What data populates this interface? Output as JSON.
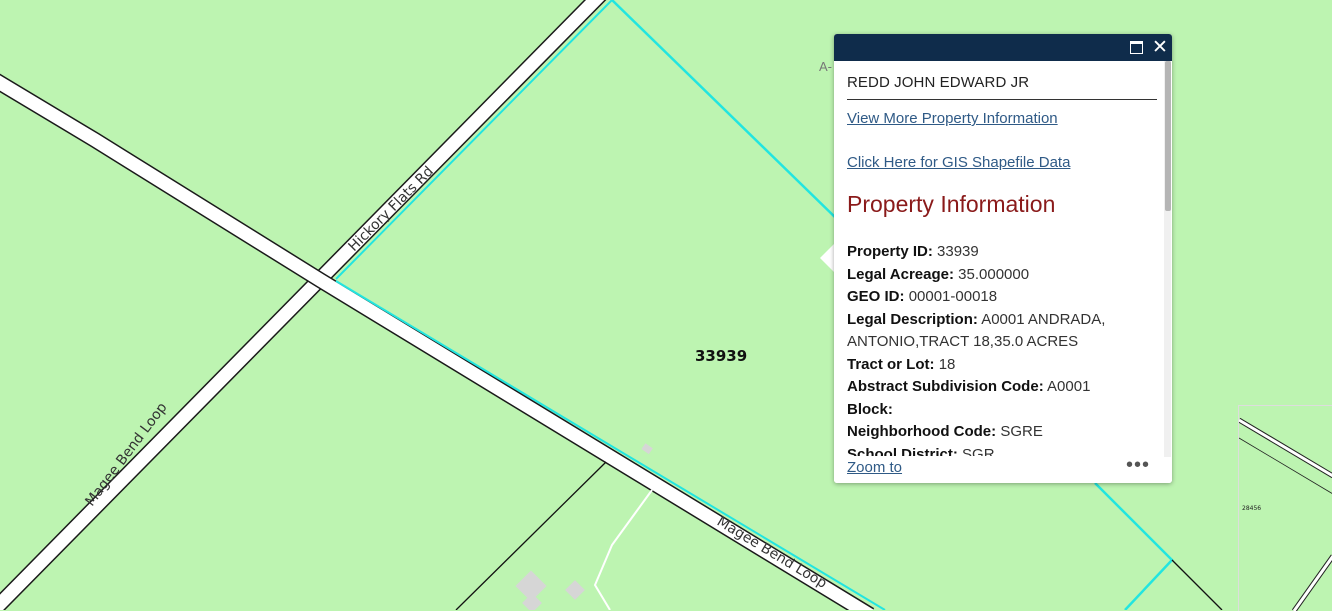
{
  "map": {
    "parcel_id_label": "33939",
    "faint_label": "A-",
    "roads": {
      "hickory": "Hickory Flats Rd",
      "magee_left": "Magee Bend Loop",
      "magee_right": "Magee Bend Loop"
    },
    "colors": {
      "land": "#bdf4b1",
      "parcel_highlight": "#22e5e0",
      "road_fill": "#ffffff",
      "boundary": "#000000"
    }
  },
  "popup": {
    "owner": "REDD JOHN EDWARD JR",
    "link_more_info": "View More Property Information",
    "link_gis": "Click Here for GIS Shapefile Data",
    "section_title": "Property Information",
    "fields": [
      {
        "label": "Property ID:",
        "value": "33939"
      },
      {
        "label": "Legal Acreage:",
        "value": "35.000000"
      },
      {
        "label": "GEO ID:",
        "value": "00001-00018"
      },
      {
        "label": "Legal Description:",
        "value": "A0001 ANDRADA, ANTONIO,TRACT 18,35.0 ACRES"
      },
      {
        "label": "Tract or Lot:",
        "value": "18"
      },
      {
        "label": "Abstract Subdivision Code:",
        "value": "A0001"
      },
      {
        "label": "Block:",
        "value": ""
      },
      {
        "label": "Neighborhood Code:",
        "value": "SGRE"
      },
      {
        "label": "School District:",
        "value": "SGR"
      }
    ],
    "footer": {
      "zoom_label": "Zoom to",
      "more_label": "•••"
    },
    "header_icons": [
      "maximize-icon",
      "close-icon"
    ],
    "header_color": "#0f2c4b"
  },
  "overview": {
    "label": "28456"
  }
}
